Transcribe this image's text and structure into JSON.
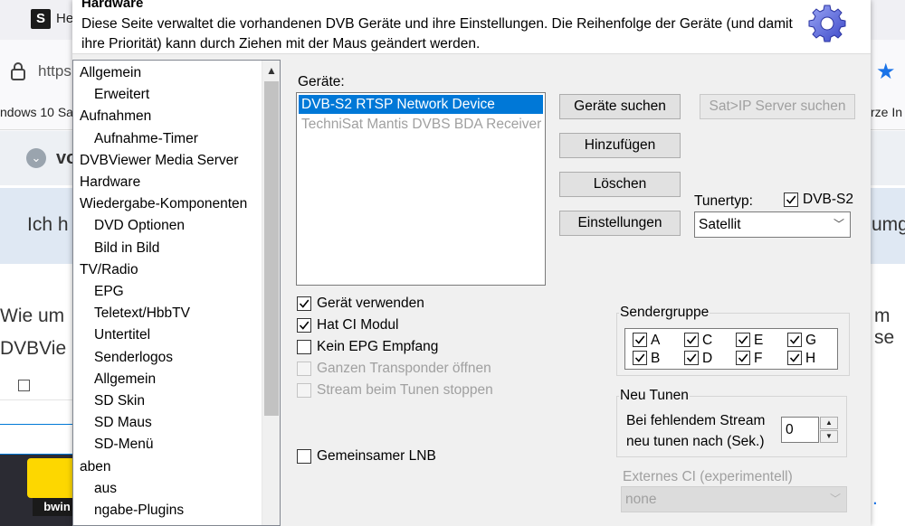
{
  "browser": {
    "tab_favicon": "S",
    "tab_text": "He",
    "url_partial": "https:",
    "bookmark_left": "ndows 10 Sa",
    "bookmark_right": "rze In",
    "page_heading_partial": "vo",
    "para1_left": "Ich h",
    "para1_right": "umg",
    "para2_left": "Wie um",
    "para2_right": "m se",
    "para3_left": "DVBVie",
    "video_logo": "bwin",
    "star_icon": "star-icon",
    "lock_icon": "lock-icon"
  },
  "dialog": {
    "header": {
      "title": "Hardware",
      "description": "Diese Seite verwaltet die vorhandenen DVB Geräte und ihre Einstellungen. Die Reihenfolge der Geräte (und damit ihre Priorität) kann durch Ziehen mit der Maus geändert werden.",
      "icon": "gear-icon"
    },
    "tree": {
      "items": [
        {
          "label": "Allgemein",
          "level": 0
        },
        {
          "label": "Erweitert",
          "level": 1
        },
        {
          "label": "Aufnahmen",
          "level": 0
        },
        {
          "label": "Aufnahme-Timer",
          "level": 1
        },
        {
          "label": "DVBViewer Media Server",
          "level": 0
        },
        {
          "label": "Hardware",
          "level": 0
        },
        {
          "label": "Wiedergabe-Komponenten",
          "level": 0
        },
        {
          "label": "DVD Optionen",
          "level": 1
        },
        {
          "label": "Bild in Bild",
          "level": 1
        },
        {
          "label": "TV/Radio",
          "level": 0
        },
        {
          "label": "EPG",
          "level": 1
        },
        {
          "label": "Teletext/HbbTV",
          "level": 1
        },
        {
          "label": "Untertitel",
          "level": 1
        },
        {
          "label": "Senderlogos",
          "level": 1
        },
        {
          "label": "Allgemein",
          "level": 1
        },
        {
          "label": "SD Skin",
          "level": 1
        },
        {
          "label": "SD Maus",
          "level": 1
        },
        {
          "label": "SD-Menü",
          "level": 1
        },
        {
          "label": "aben",
          "level": 0
        },
        {
          "label": "aus",
          "level": 1
        },
        {
          "label": "ngabe-Plugins",
          "level": 1
        }
      ]
    },
    "devices": {
      "label": "Geräte:",
      "items": [
        {
          "name": "DVB-S2 RTSP Network Device",
          "state": "selected"
        },
        {
          "name": "TechniSat Mantis DVBS BDA Receiver",
          "state": "disabled"
        }
      ]
    },
    "buttons": {
      "search_devices": "Geräte suchen",
      "sat_ip_search": "Sat>IP Server suchen",
      "add": "Hinzufügen",
      "delete": "Löschen",
      "settings": "Einstellungen"
    },
    "tuner": {
      "label": "Tunertyp:",
      "dvb_s2_label": "DVB-S2",
      "dvb_s2_checked": true,
      "selected": "Satellit"
    },
    "options": [
      {
        "label": "Gerät verwenden",
        "checked": true,
        "enabled": true
      },
      {
        "label": "Hat CI Modul",
        "checked": true,
        "enabled": true
      },
      {
        "label": "Kein EPG Empfang",
        "checked": false,
        "enabled": true
      },
      {
        "label": "Ganzen Transponder öffnen",
        "checked": false,
        "enabled": false
      },
      {
        "label": "Stream beim Tunen stoppen",
        "checked": false,
        "enabled": false
      }
    ],
    "shared_lnb": {
      "label": "Gemeinsamer LNB",
      "checked": false
    },
    "sendergruppe": {
      "title": "Sendergruppe",
      "groups": [
        {
          "label": "A",
          "checked": true
        },
        {
          "label": "C",
          "checked": true
        },
        {
          "label": "E",
          "checked": true
        },
        {
          "label": "G",
          "checked": true
        },
        {
          "label": "B",
          "checked": true
        },
        {
          "label": "D",
          "checked": true
        },
        {
          "label": "F",
          "checked": true
        },
        {
          "label": "H",
          "checked": true
        }
      ]
    },
    "retune": {
      "title": "Neu Tunen",
      "line1": "Bei fehlendem Stream",
      "line2": "neu tunen nach (Sek.)",
      "value": "0"
    },
    "external_ci": {
      "title": "Externes CI (experimentell)",
      "selected": "none"
    }
  }
}
